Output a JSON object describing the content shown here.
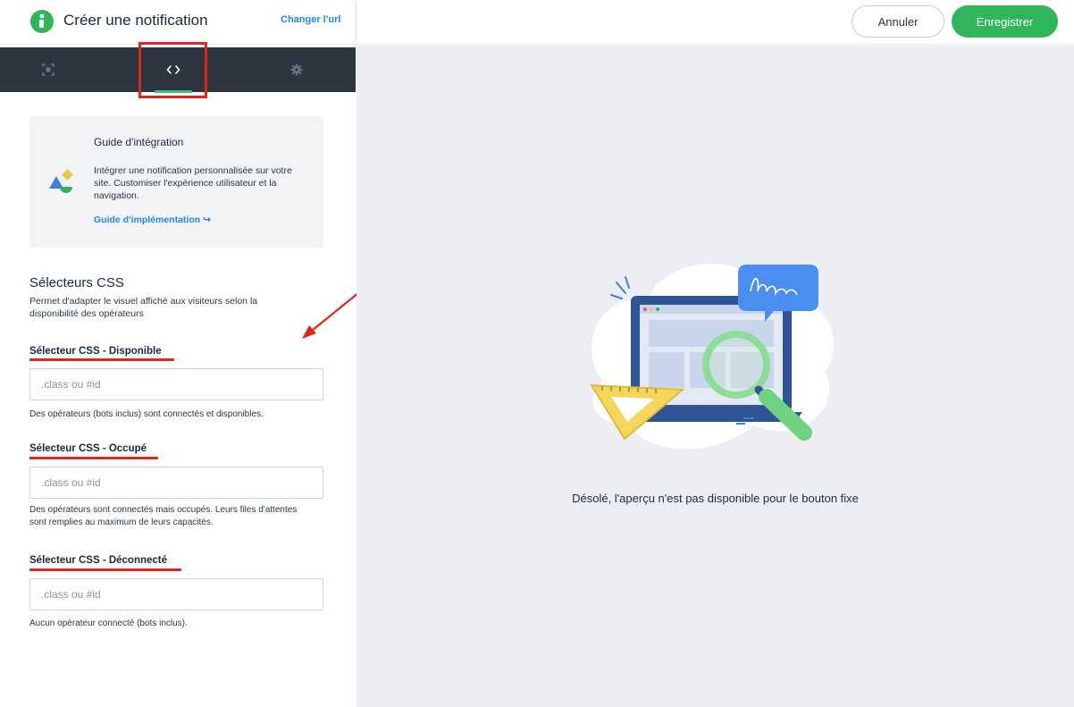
{
  "header": {
    "title": "Créer une notification",
    "change_url": "Changer l'url",
    "cancel_label": "Annuler",
    "save_label": "Enregistrer"
  },
  "tabs": [
    {
      "icon": "screen-capture-icon",
      "active": false
    },
    {
      "icon": "code-icon",
      "active": true
    },
    {
      "icon": "gear-icon",
      "active": false
    }
  ],
  "guide": {
    "title": "Guide d'intégration",
    "description": "Intégrer une notification personnalisée sur votre site. Customiser l'expérience utilisateur et la navigation.",
    "link": "Guide d'implémentation ↪"
  },
  "css_section": {
    "title": "Sélecteurs CSS",
    "description": "Permet d'adapter le visuel affiché aux visiteurs selon la disponibilité des opérateurs",
    "fields": [
      {
        "label": "Sélecteur CSS - Disponible",
        "placeholder": ".class ou #id",
        "value": "",
        "help": "Des opérateurs (bots inclus) sont connectés et disponibles."
      },
      {
        "label": "Sélecteur CSS - Occupé",
        "placeholder": ".class ou #id",
        "value": "",
        "help": "Des opérateurs sont connectés mais occupés. Leurs files d'attentes sont remplies au maximum de leurs capacités."
      },
      {
        "label": "Sélecteur CSS - Déconnecté",
        "placeholder": ".class ou #id",
        "value": "",
        "help": "Aucun opérateur connecté (bots inclus)."
      }
    ]
  },
  "preview": {
    "message": "Désolé, l'aperçu n'est pas disponible pour le bouton fixe"
  },
  "colors": {
    "accent_green": "#2fb55a",
    "link_blue": "#1e88e5",
    "tabbar_bg": "#2d3540",
    "annotation_red": "#e0261a",
    "preview_bg": "#eceef3"
  }
}
